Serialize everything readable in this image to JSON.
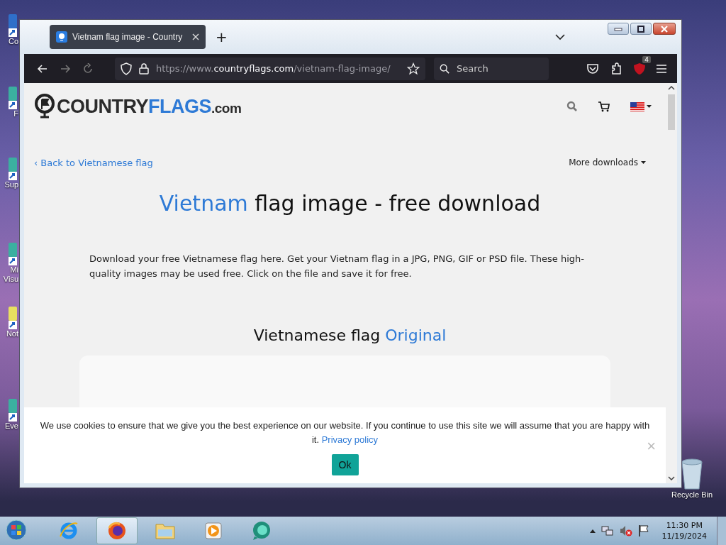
{
  "desktop_icons": [
    {
      "label": "Co",
      "kind": "computer"
    },
    {
      "label": "F",
      "kind": "app"
    },
    {
      "label": "Sup",
      "kind": "app"
    },
    {
      "label": "Mi Visu",
      "kind": "app"
    },
    {
      "label": "Not",
      "kind": "notes"
    },
    {
      "label": "Eve",
      "kind": "app"
    },
    {
      "label": "Recycle Bin",
      "kind": "bin"
    }
  ],
  "browser": {
    "tabs": [
      {
        "title": "Vietnam flag image - Country",
        "selected": true
      }
    ],
    "new_tab": "+",
    "url": {
      "scheme": "https://www.",
      "domain": "countryflags.com",
      "path": "/vietnam-flag-image/"
    },
    "search": {
      "placeholder": "Search"
    },
    "extension_badge": "4"
  },
  "page": {
    "logo": {
      "part1": "COUNTRY",
      "part2": "FLAGS",
      "part3": ".com"
    },
    "back_link": "‹ Back to Vietnamese flag",
    "more_downloads": "More downloads",
    "heading": {
      "highlight": "Vietnam",
      "rest": "flag image - free download"
    },
    "intro": "Download your free Vietnamese flag here. Get your Vietnam flag in a JPG, PNG, GIF or PSD file. These high-quality images may be used free. Click on the file and save it for free.",
    "subheading": {
      "rest": "Vietnamese flag",
      "highlight": "Original"
    }
  },
  "cookie_banner": {
    "text": "We use cookies to ensure that we give you the best experience on our website. If you continue to use this site we will assume that you are happy with it.",
    "link": "Privacy policy",
    "close": "×",
    "ok": "Ok"
  },
  "taskbar": {
    "items": [
      {
        "kind": "ie",
        "selected": false
      },
      {
        "kind": "firefox",
        "selected": true
      },
      {
        "kind": "folder",
        "selected": false
      },
      {
        "kind": "media",
        "selected": false
      },
      {
        "kind": "chat",
        "selected": false
      }
    ],
    "time": "11:30 PM",
    "date": "11/19/2024"
  }
}
